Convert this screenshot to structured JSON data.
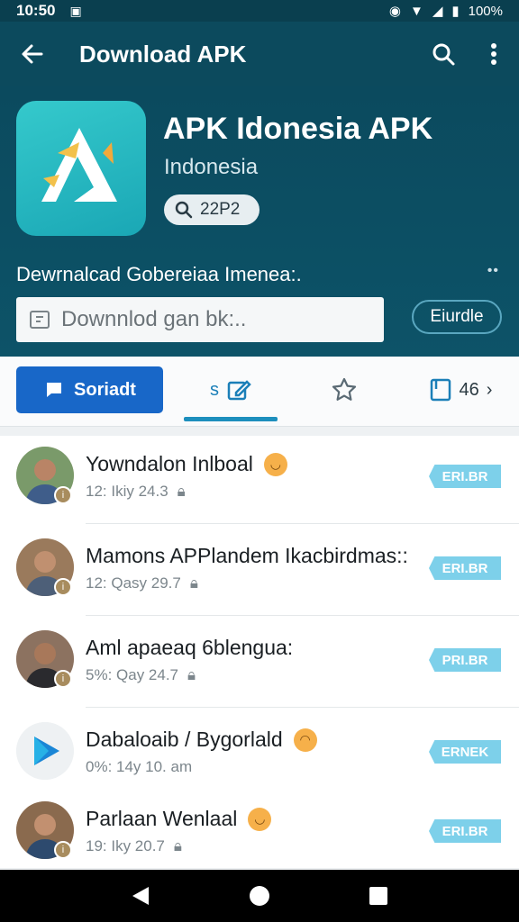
{
  "status": {
    "time": "10:50",
    "battery": "100%"
  },
  "app_bar": {
    "title": "Download APK"
  },
  "app": {
    "name": "APK Idonesia APK",
    "subtitle": "Indonesia",
    "chip_value": "22P2",
    "description": "Dewrnalcad Gobereiaa Imenea:.",
    "more": "••",
    "search_placeholder": "Downnlod gan bk:..",
    "search_button": "Eiurdle"
  },
  "tabs": [
    {
      "label": "Soriadt",
      "icon": "chat-bubble-icon"
    },
    {
      "label": "s",
      "icon": "edit-icon"
    },
    {
      "label": "",
      "icon": "star-icon"
    },
    {
      "label": "46",
      "icon": "bookmark-icon"
    }
  ],
  "list": [
    {
      "name": "Yowndalon Inlboal",
      "meta": "12: Ikiy 24.3",
      "tag": "ERI.BR",
      "emoji": true,
      "avatar": "person"
    },
    {
      "name": "Mamons APPlandem Ikacbirdmas::",
      "meta": "12: Qasy 29.7",
      "tag": "ERI.BR",
      "emoji": false,
      "avatar": "person"
    },
    {
      "name": "Aml apaeaq 6blengua:",
      "meta": "5%: Qay 24.7",
      "tag": "PRI.BR",
      "emoji": false,
      "avatar": "person"
    },
    {
      "name": "Dabaloaib / Bygorlald",
      "meta": "0%: 14y 10. am",
      "tag": "ERNEK",
      "emoji": true,
      "avatar": "play"
    },
    {
      "name": "Parlaan Wenlaal",
      "meta": "19: Iky 20.7",
      "tag": "ERI.BR",
      "emoji": true,
      "avatar": "person"
    }
  ],
  "colors": {
    "app_bar": "#0c4a5d",
    "accent": "#1867c8",
    "tag": "#7dd0ea"
  }
}
